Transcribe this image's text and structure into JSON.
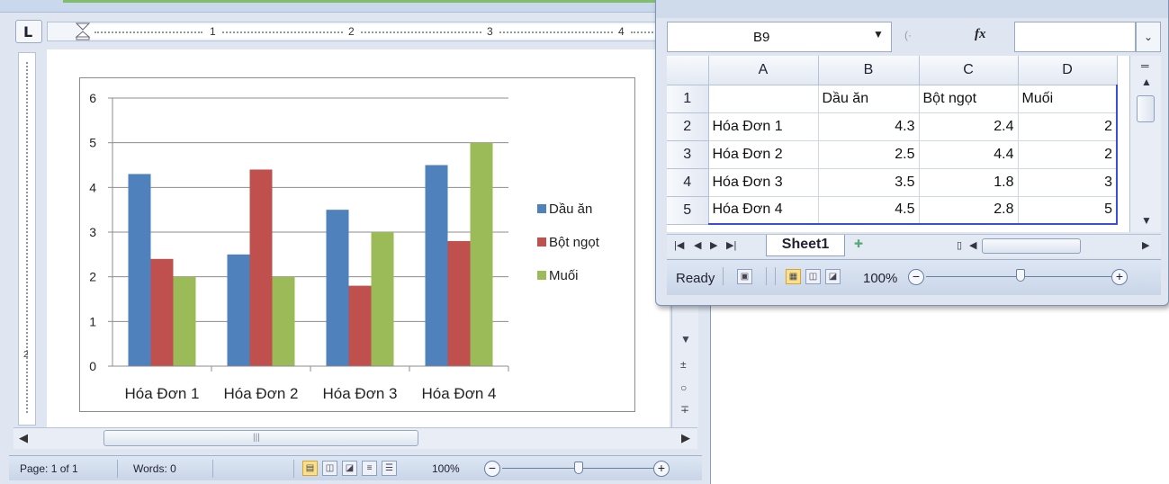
{
  "word": {
    "ruler_numbers": [
      "1",
      "2",
      "3",
      "4"
    ],
    "vertical_ruler_number": "2",
    "status": {
      "page": "Page: 1 of 1",
      "words": "Words: 0",
      "zoom": "100%"
    }
  },
  "chart_data": {
    "type": "bar",
    "categories": [
      "Hóa Đơn 1",
      "Hóa Đơn 2",
      "Hóa Đơn 3",
      "Hóa Đơn 4"
    ],
    "series": [
      {
        "name": "Dầu ăn",
        "values": [
          4.3,
          2.5,
          3.5,
          4.5
        ],
        "color": "#4f81bd"
      },
      {
        "name": "Bột ngọt",
        "values": [
          2.4,
          4.4,
          1.8,
          2.8
        ],
        "color": "#c0504d"
      },
      {
        "name": "Muối",
        "values": [
          2,
          2,
          3,
          5
        ],
        "color": "#9bbb59"
      }
    ],
    "ylim": [
      0,
      6
    ],
    "yticks": [
      "0",
      "1",
      "2",
      "3",
      "4",
      "5",
      "6"
    ],
    "grid": true,
    "legend": "right"
  },
  "excel": {
    "name_box": "B9",
    "fx_label": "fx",
    "columns": [
      "A",
      "B",
      "C",
      "D"
    ],
    "rows": [
      {
        "num": "1",
        "a": "",
        "b": "Dầu ăn",
        "c": "Bột ngọt",
        "d": "Muối"
      },
      {
        "num": "2",
        "a": "Hóa Đơn 1",
        "b": "4.3",
        "c": "2.4",
        "d": "2"
      },
      {
        "num": "3",
        "a": "Hóa Đơn 2",
        "b": "2.5",
        "c": "4.4",
        "d": "2"
      },
      {
        "num": "4",
        "a": "Hóa Đơn 3",
        "b": "3.5",
        "c": "1.8",
        "d": "3"
      },
      {
        "num": "5",
        "a": "Hóa Đơn 4",
        "b": "4.5",
        "c": "2.8",
        "d": "5"
      }
    ],
    "sheet_tab": "Sheet1",
    "status": {
      "ready": "Ready",
      "zoom": "100%"
    }
  }
}
